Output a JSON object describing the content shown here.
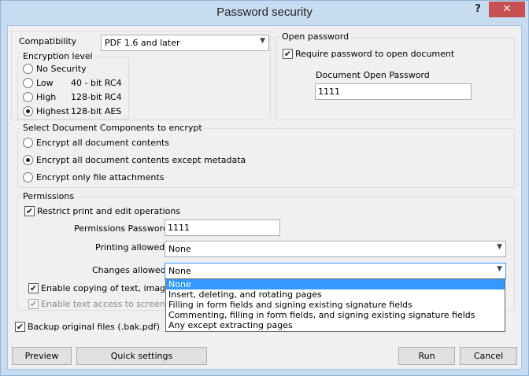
{
  "window": {
    "title": "Password security",
    "help": "?",
    "close": "✕"
  },
  "compatibility": {
    "label": "Compatibility",
    "value": "PDF 1.6 and later"
  },
  "encryption": {
    "label": "Encryption level",
    "options": [
      {
        "name": "No Security",
        "detail": "",
        "checked": false
      },
      {
        "name": "Low",
        "detail": "40 - bit RC4",
        "checked": false
      },
      {
        "name": "High",
        "detail": "128-bit RC4",
        "checked": false
      },
      {
        "name": "Highest",
        "detail": "128-bit AES",
        "checked": true
      }
    ]
  },
  "open_password": {
    "label": "Open password",
    "require_label": "Require password to open document",
    "require_checked": true,
    "field_label": "Document Open Password",
    "value": "1111"
  },
  "components": {
    "label": "Select Document Components to encrypt",
    "options": [
      {
        "label": "Encrypt all document contents",
        "checked": false
      },
      {
        "label": "Encrypt all document contents except metadata",
        "checked": true
      },
      {
        "label": "Encrypt only file attachments",
        "checked": false
      }
    ]
  },
  "permissions": {
    "label": "Permissions",
    "restrict_label": "Restrict print and edit operations",
    "restrict_checked": true,
    "password_label": "Permissions Password",
    "password_value": "1111",
    "printing_label": "Printing allowed",
    "printing_value": "None",
    "changes_label": "Changes allowed",
    "changes_value": "None",
    "copy_label": "Enable copying of text, images,",
    "copy_checked": true,
    "screen_reader_label": "Enable text access to screen rea",
    "screen_reader_checked": true
  },
  "changes_dropdown": {
    "options": [
      "None",
      "Insert, deleting, and rotating pages",
      "Filling in form fields and signing existing signature fields",
      "Commenting, filling in form fields, and signing existing signature fields",
      "Any except extracting pages"
    ],
    "selected_index": 0
  },
  "backup": {
    "label": "Backup original files (.bak.pdf)",
    "checked": true
  },
  "buttons": {
    "preview": "Preview",
    "quick_settings": "Quick settings",
    "run": "Run",
    "cancel": "Cancel"
  },
  "checkmark": "✔",
  "colors": {
    "title_bar": "#c8dcf1",
    "close_button": "#c75050",
    "selection": "#3399ff",
    "dialog_bg": "#f0f0f0"
  }
}
